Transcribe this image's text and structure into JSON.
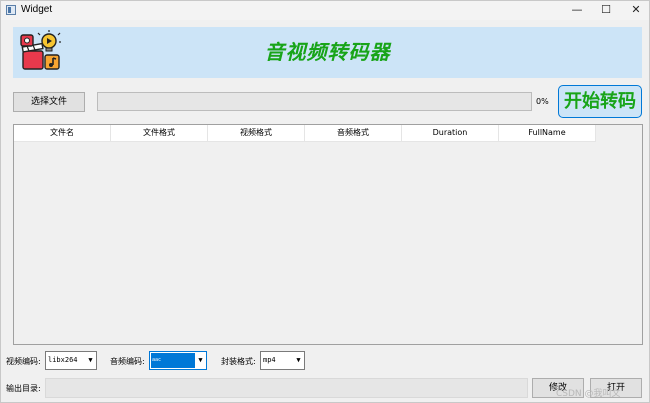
{
  "window": {
    "title": "Widget"
  },
  "window_controls": {
    "minimize": "—",
    "maximize": "☐",
    "close": "✕"
  },
  "banner": {
    "title": "音视频转码器"
  },
  "toolbar": {
    "select_file_label": "选择文件",
    "progress_percent": 0,
    "progress_text": "0%",
    "start_label": "开始转码"
  },
  "table": {
    "columns": [
      "文件名",
      "文件格式",
      "视频格式",
      "音频格式",
      "Duration",
      "FullName"
    ],
    "rows": []
  },
  "encoding": {
    "video_label": "视频编码:",
    "video_value": "libx264",
    "audio_label": "音频编码:",
    "audio_value": "aac",
    "container_label": "封装格式:",
    "container_value": "mp4"
  },
  "output": {
    "label": "输出目录:",
    "value": "",
    "modify_label": "修改",
    "open_label": "打开"
  },
  "watermark": "CSDN @我叫文"
}
